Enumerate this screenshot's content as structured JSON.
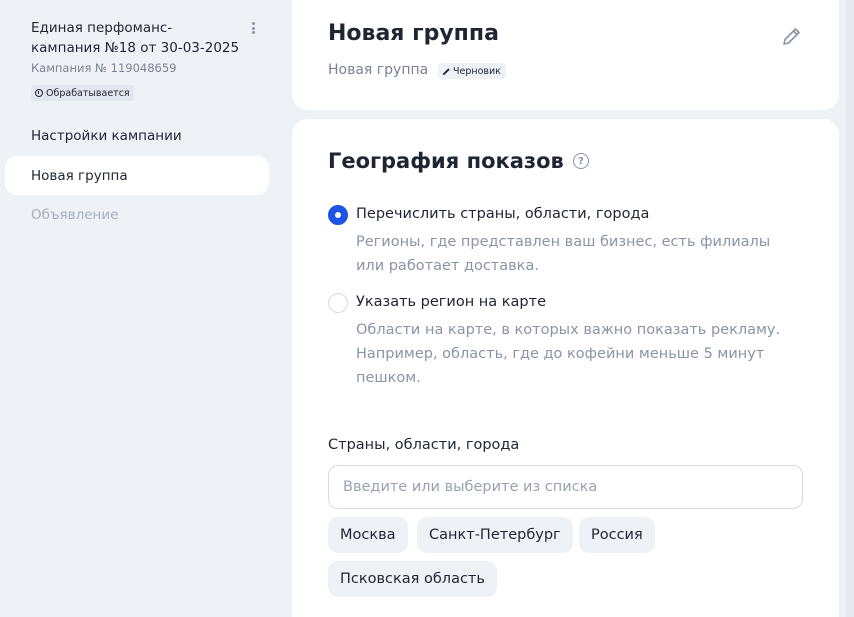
{
  "sidebar": {
    "campaign_title": "Единая перфоманс-кампания №18 от 30-03-2025",
    "campaign_id": "Кампания № 119048659",
    "status": "Обрабатывается",
    "items": [
      {
        "label": "Настройки кампании",
        "state": "normal"
      },
      {
        "label": "Новая группа",
        "state": "active"
      },
      {
        "label": "Объявление",
        "state": "disabled"
      }
    ]
  },
  "header": {
    "title": "Новая группа",
    "subtitle": "Новая группа",
    "draft_badge": "Черновик"
  },
  "geo": {
    "title": "География показов",
    "help_icon": "?",
    "options": [
      {
        "label": "Перечислить страны, области, города",
        "description": "Регионы, где представлен ваш бизнес, есть филиалы или работает доставка.",
        "checked": true
      },
      {
        "label": "Указать регион на карте",
        "description": "Области на карте, в которых важно показать рекламу. Например, область, где до кофейни меньше 5 минут пешком.",
        "checked": false
      }
    ],
    "field_label": "Страны, области, города",
    "input_placeholder": "Введите или выберите из списка",
    "chips": [
      "Москва",
      "Санкт-Петербург",
      "Россия",
      "Псковская область"
    ]
  },
  "colors": {
    "accent": "#1e53e5",
    "background": "#eef1f6",
    "muted_text": "#8a94a6"
  }
}
